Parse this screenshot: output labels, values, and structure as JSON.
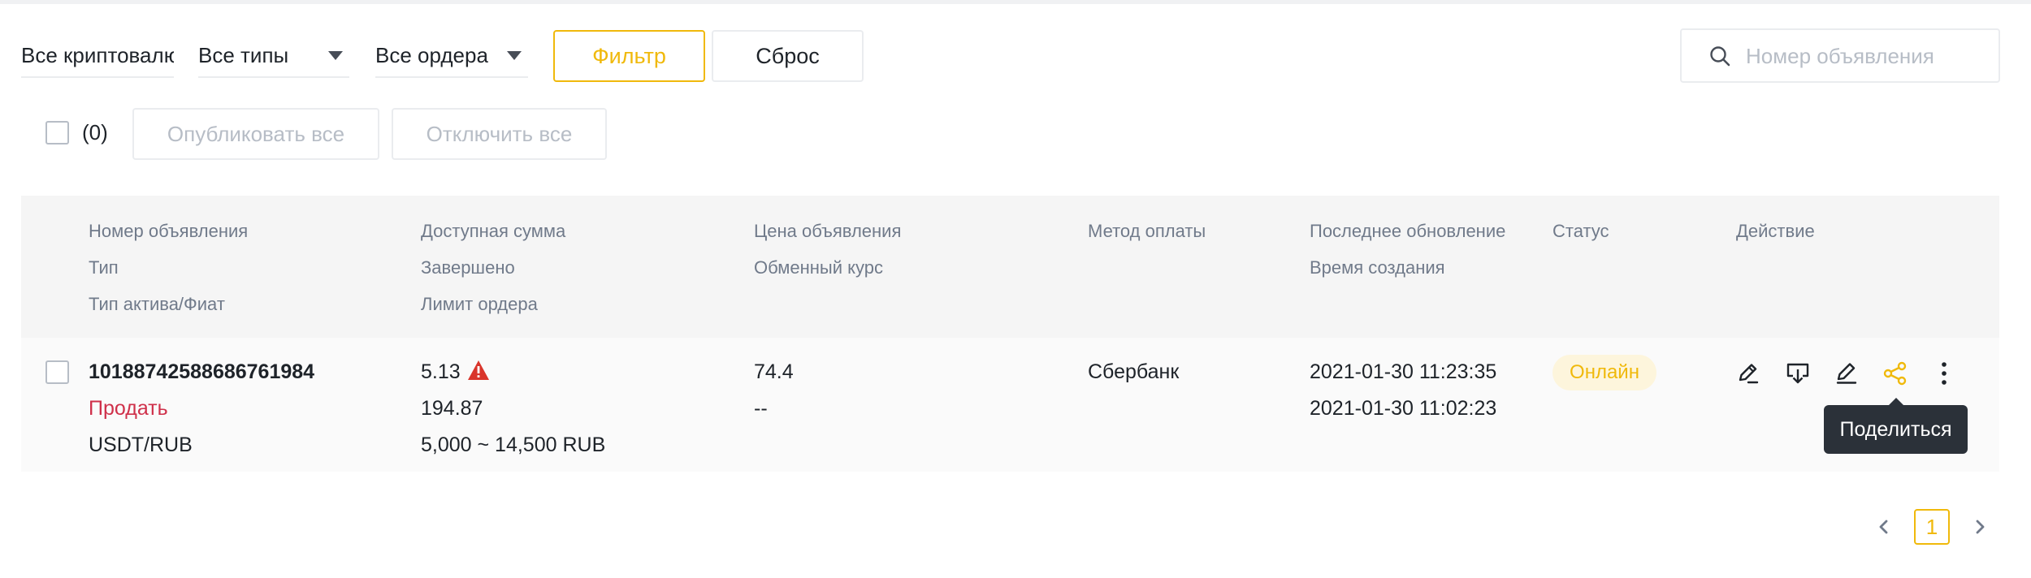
{
  "filters": {
    "crypto": "Все криптовалюты",
    "types": "Все типы",
    "orders": "Все ордера",
    "filter_label": "Фильтр",
    "reset_label": "Сброс",
    "search_placeholder": "Номер объявления"
  },
  "bulk": {
    "count": "(0)",
    "publish_all": "Опубликовать все",
    "disable_all": "Отключить все"
  },
  "table": {
    "headers": {
      "col1": [
        "Номер объявления",
        "Тип",
        "Тип актива/Фиат"
      ],
      "col2": [
        "Доступная сумма",
        "Завершено",
        "Лимит ордера"
      ],
      "col3": [
        "Цена объявления",
        "Обменный курс"
      ],
      "col4": [
        "Метод оплаты"
      ],
      "col5": [
        "Последнее обновление",
        "Время создания"
      ],
      "col6": [
        "Статус"
      ],
      "col7": [
        "Действие"
      ]
    },
    "rows": [
      {
        "ad_number": "10188742588686761984",
        "type": "Продать",
        "asset_fiat": "USDT/RUB",
        "available": "5.13",
        "completed": "194.87",
        "limit": "5,000 ~ 14,500 RUB",
        "price": "74.4",
        "rate": "--",
        "payment": "Сбербанк",
        "updated": "2021-01-30 11:23:35",
        "created": "2021-01-30 11:02:23",
        "status": "Онлайн"
      }
    ]
  },
  "tooltip": "Поделиться",
  "pagination": {
    "current": "1"
  },
  "colors": {
    "accent": "#f0b90b",
    "sell": "#cf304a",
    "warning": "#d9352b"
  },
  "icons": [
    "search-icon",
    "warning-icon",
    "edit-note-icon",
    "download-icon",
    "pencil-icon",
    "share-icon",
    "more-vertical-icon",
    "chevron-left-icon",
    "chevron-right-icon"
  ]
}
